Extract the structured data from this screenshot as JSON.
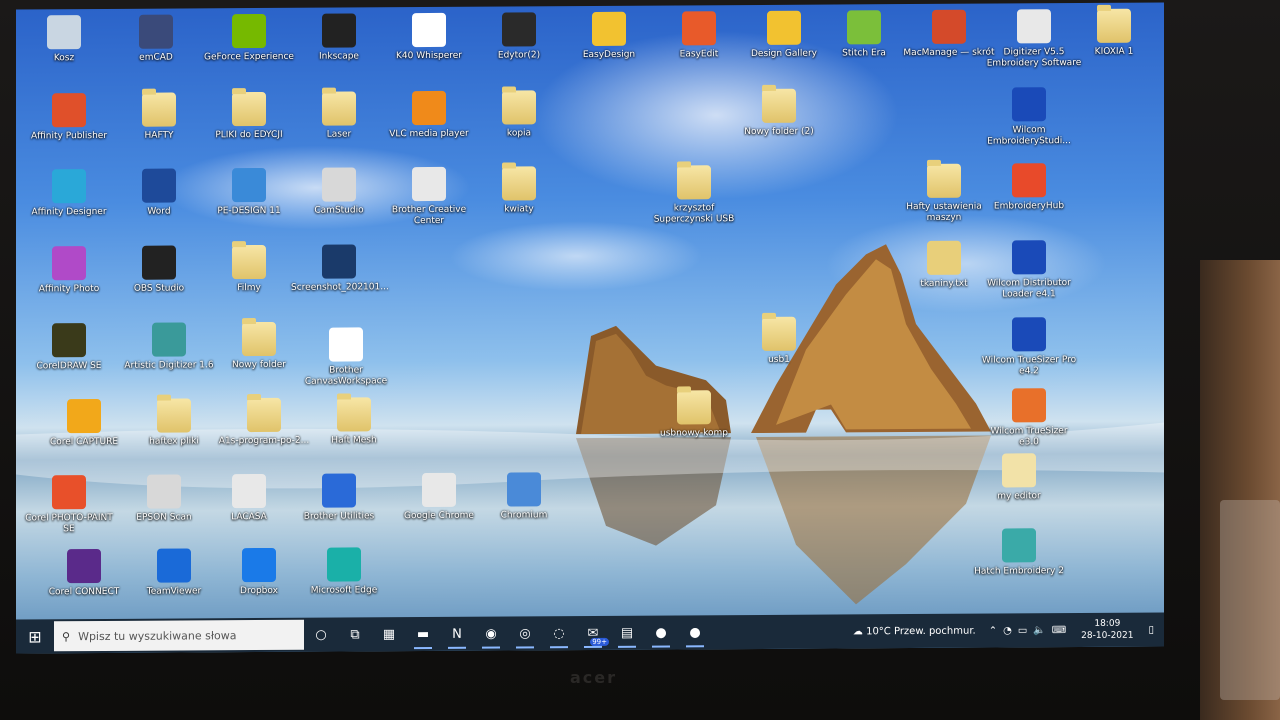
{
  "desktop": {
    "icons": [
      {
        "label": "Kosz",
        "icon": "recycle-bin-icon",
        "color": "#c9d6e2"
      },
      {
        "label": "emCAD",
        "icon": "emcad-icon",
        "color": "#3a4a7a"
      },
      {
        "label": "GeForce Experience",
        "icon": "geforce-icon",
        "color": "#76b900"
      },
      {
        "label": "Inkscape",
        "icon": "inkscape-icon",
        "color": "#222222"
      },
      {
        "label": "K40 Whisperer",
        "icon": "k40-icon",
        "color": "#ffffff"
      },
      {
        "label": "Edytor(2)",
        "icon": "editor-icon",
        "color": "#2a2a2a"
      },
      {
        "label": "EasyDesign",
        "icon": "easydesign-icon",
        "color": "#f2c230"
      },
      {
        "label": "EasyEdit",
        "icon": "easyedit-icon",
        "color": "#e85a2a"
      },
      {
        "label": "Design Gallery",
        "icon": "design-gallery-icon",
        "color": "#f2c230"
      },
      {
        "label": "Stitch Era",
        "icon": "stitch-era-icon",
        "color": "#7bbf3a"
      },
      {
        "label": "MacManage — skrót",
        "icon": "macmanage-icon",
        "color": "#d44a2a"
      },
      {
        "label": "Digitizer V5.5 Embroidery Software",
        "icon": "digitizer-icon",
        "color": "#e8e8e8"
      },
      {
        "label": "KIOXIA 1",
        "icon": "folder-icon",
        "color": "#e8cf7a"
      },
      {
        "label": "Affinity Publisher",
        "icon": "affinity-publisher-icon",
        "color": "#e0502a"
      },
      {
        "label": "HAFTY",
        "icon": "folder-icon",
        "color": "#e8cf7a"
      },
      {
        "label": "PLIKI do EDYCJI",
        "icon": "folder-icon",
        "color": "#e8cf7a"
      },
      {
        "label": "Laser",
        "icon": "folder-icon",
        "color": "#e8cf7a"
      },
      {
        "label": "VLC media player",
        "icon": "vlc-icon",
        "color": "#f08a1a"
      },
      {
        "label": "kopia",
        "icon": "folder-icon",
        "color": "#e8cf7a"
      },
      {
        "label": "Nowy folder (2)",
        "icon": "folder-icon",
        "color": "#e8cf7a"
      },
      {
        "label": "Wilcom EmbroideryStudi...",
        "icon": "wilcom-icon",
        "color": "#1a4ab8"
      },
      {
        "label": "Affinity Designer",
        "icon": "affinity-designer-icon",
        "color": "#2aa8d8"
      },
      {
        "label": "Word",
        "icon": "word-icon",
        "color": "#1e4a9a"
      },
      {
        "label": "PE-DESIGN 11",
        "icon": "pe-design-icon",
        "color": "#3a8ad8"
      },
      {
        "label": "CamStudio",
        "icon": "camstudio-icon",
        "color": "#d8d8d8"
      },
      {
        "label": "Brother Creative Center",
        "icon": "brother-creative-icon",
        "color": "#e8e8e8"
      },
      {
        "label": "kwiaty",
        "icon": "folder-icon",
        "color": "#e8cf7a"
      },
      {
        "label": "krzysztof Superczynski USB",
        "icon": "folder-icon",
        "color": "#e8cf7a"
      },
      {
        "label": "Hafty ustawienia maszyn",
        "icon": "folder-icon",
        "color": "#e8cf7a"
      },
      {
        "label": "EmbroideryHub",
        "icon": "embroideryhub-icon",
        "color": "#e84a2a"
      },
      {
        "label": "Affinity Photo",
        "icon": "affinity-photo-icon",
        "color": "#b04ac8"
      },
      {
        "label": "OBS Studio",
        "icon": "obs-icon",
        "color": "#222222"
      },
      {
        "label": "Filmy",
        "icon": "folder-icon",
        "color": "#e8cf7a"
      },
      {
        "label": "Screenshot_202101...",
        "icon": "screenshot-icon",
        "color": "#1a3a6a"
      },
      {
        "label": "Brother CanvasWorkspace",
        "icon": "canvasworkspace-icon",
        "color": "#ffffff"
      },
      {
        "label": "usb1",
        "icon": "folder-icon",
        "color": "#e8cf7a"
      },
      {
        "label": "tkaniny.txt",
        "icon": "text-file-icon",
        "color": "#e8cf7a"
      },
      {
        "label": "Wilcom Distributor Loader e4.1",
        "icon": "wilcom-distributor-icon",
        "color": "#1a4ab8"
      },
      {
        "label": "CorelDRAW SE",
        "icon": "coreldraw-icon",
        "color": "#3a3a1a"
      },
      {
        "label": "Artistic Digitizer 1.6",
        "icon": "artistic-digitizer-icon",
        "color": "#3a9a9a"
      },
      {
        "label": "Nowy folder",
        "icon": "folder-icon",
        "color": "#e8cf7a"
      },
      {
        "label": "Wilcom TrueSizer Pro e4.2",
        "icon": "truesizer-pro-icon",
        "color": "#1a4ab8"
      },
      {
        "label": "Corel CAPTURE",
        "icon": "corel-capture-icon",
        "color": "#f2a81a"
      },
      {
        "label": "haftex pliki",
        "icon": "folder-icon",
        "color": "#e8cf7a"
      },
      {
        "label": "A1s-program-po-2...",
        "icon": "folder-icon",
        "color": "#e8cf7a"
      },
      {
        "label": "Haft Mesh",
        "icon": "folder-icon",
        "color": "#e8cf7a"
      },
      {
        "label": "usbnowy-komp",
        "icon": "folder-icon",
        "color": "#e8cf7a"
      },
      {
        "label": "Wilcom TrueSizer e3.0",
        "icon": "truesizer-icon",
        "color": "#e8702a"
      },
      {
        "label": "Corel PHOTO-PAINT SE",
        "icon": "photo-paint-icon",
        "color": "#e8502a"
      },
      {
        "label": "EPSON Scan",
        "icon": "epson-scan-icon",
        "color": "#d8d8d8"
      },
      {
        "label": "LACASA",
        "icon": "lacasa-icon",
        "color": "#e8e8e8"
      },
      {
        "label": "Brother Utilities",
        "icon": "brother-utilities-icon",
        "color": "#2a6ad8"
      },
      {
        "label": "Google Chrome",
        "icon": "chrome-icon",
        "color": "#e8e8e8"
      },
      {
        "label": "Chromium",
        "icon": "chromium-icon",
        "color": "#4a8ad8"
      },
      {
        "label": "my editor",
        "icon": "my-editor-icon",
        "color": "#f2e2a8"
      },
      {
        "label": "Corel CONNECT",
        "icon": "corel-connect-icon",
        "color": "#5a2a8a"
      },
      {
        "label": "TeamViewer",
        "icon": "teamviewer-icon",
        "color": "#1a6ad8"
      },
      {
        "label": "Dropbox",
        "icon": "dropbox-icon",
        "color": "#1a7ae8"
      },
      {
        "label": "Microsoft Edge",
        "icon": "edge-icon",
        "color": "#1ab0a8"
      },
      {
        "label": "Hatch Embroidery 2",
        "icon": "hatch-icon",
        "color": "#3aaaa8"
      }
    ]
  },
  "taskbar": {
    "search_placeholder": "Wpisz tu wyszukiwane słowa",
    "buttons": [
      {
        "name": "cortana-button",
        "glyph": "○"
      },
      {
        "name": "task-view-button",
        "glyph": "⧉"
      },
      {
        "name": "calendar-app-button",
        "glyph": "▦"
      },
      {
        "name": "file-explorer-button",
        "glyph": "▬"
      },
      {
        "name": "n-app-button",
        "glyph": "N"
      },
      {
        "name": "edge-taskbar-button",
        "glyph": "◉"
      },
      {
        "name": "chromium-taskbar-button",
        "glyph": "◎"
      },
      {
        "name": "obs-taskbar-button",
        "glyph": "◌"
      },
      {
        "name": "mail-taskbar-button",
        "glyph": "✉"
      },
      {
        "name": "calculator-taskbar-button",
        "glyph": "▤"
      },
      {
        "name": "app-taskbar-button-1",
        "glyph": "●"
      },
      {
        "name": "app-taskbar-button-2",
        "glyph": "●"
      }
    ],
    "mail_badge": "99+",
    "weather": "10°C Przew. pochmur.",
    "time": "18:09",
    "date": "28-10-2021"
  },
  "laptop_brand": "acer"
}
